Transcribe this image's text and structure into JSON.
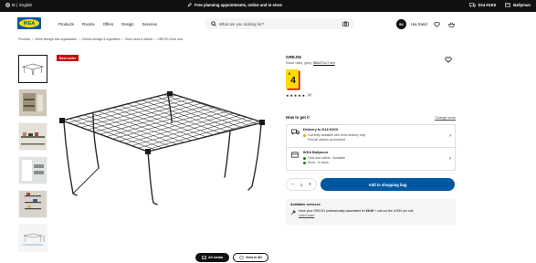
{
  "topbar": {
    "language": "English",
    "promo": "Free planning appointments, online and in-store",
    "delivery_postcode": "D14 H1K6",
    "store": "Ballymun"
  },
  "header": {
    "logo_text": "IKEA",
    "nav": [
      "Products",
      "Rooms",
      "Offers",
      "Design",
      "Services"
    ],
    "search_placeholder": "What are you looking for?",
    "user_initials": "SK",
    "user_greeting": "Hej Sand"
  },
  "breadcrumb": [
    "Products",
    "Home storage and organisation",
    "Clothes storage & organisers",
    "Shoe racks & stands",
    "GREJIG Shoe rack"
  ],
  "gallery": {
    "badge": "Best seller",
    "buttons": [
      "All media",
      "View in 3D"
    ]
  },
  "product": {
    "name": "GREJIG",
    "description": "Shoe rack, grey,",
    "size_link": "58x27x17 cm",
    "currency": "€",
    "price": "4",
    "rating_value": 4.5,
    "rating_count": "(8)"
  },
  "fulfilment": {
    "heading": "How to get it",
    "change_store": "Change store",
    "delivery_title": "Delivery to D14 H1K6",
    "delivery_line1": "Currently available with truck delivery only",
    "delivery_line2": "Find all options at checkout",
    "store_title": "IKEA Ballymun",
    "store_line1": "Click and collect - Available",
    "store_line2": "Store - In stock"
  },
  "purchase": {
    "quantity": "1",
    "add_to_bag": "Add to shopping bag"
  },
  "services": {
    "heading": "Available services",
    "text_pre": "Have your GREJIG professionally assembled for",
    "assembly_price": "€9.00",
    "text_post": "+ call out fee of €30 per unit.",
    "learn_more": "Learn more"
  },
  "colors": {
    "ikea_blue": "#0058a3",
    "ikea_yellow": "#ffdb00",
    "badge_red": "#cc0008",
    "warn_orange": "#f0a500",
    "stock_green": "#0a8a00"
  },
  "icons": {
    "globe": "globe-icon",
    "pencil": "pencil-icon",
    "truck": "truck-icon",
    "store": "store-icon",
    "search": "search-icon",
    "camera": "camera-icon",
    "heart": "heart-icon",
    "bag": "bag-icon"
  }
}
